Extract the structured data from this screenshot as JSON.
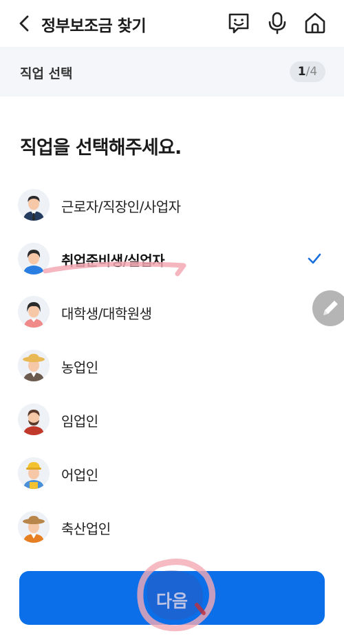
{
  "header": {
    "title": "정부보조금 찾기",
    "back_icon": "chevron-left-icon",
    "icons": [
      "chat-smile-icon",
      "microphone-icon",
      "home-icon"
    ]
  },
  "step": {
    "label": "직업 선택",
    "current": "1",
    "separator": "/",
    "total": "4"
  },
  "main": {
    "heading": "직업을 선택해주세요.",
    "occupations": [
      {
        "label": "근로자/직장인/사업자",
        "selected": false
      },
      {
        "label": "취업준비생/실업자",
        "selected": true
      },
      {
        "label": "대학생/대학원생",
        "selected": false
      },
      {
        "label": "농업인",
        "selected": false
      },
      {
        "label": "임업인",
        "selected": false
      },
      {
        "label": "어업인",
        "selected": false
      },
      {
        "label": "축산업인",
        "selected": false
      }
    ]
  },
  "footer": {
    "next_label": "다음"
  },
  "colors": {
    "accent": "#0a6fe8",
    "check": "#1a6fe0",
    "subbar_bg": "#f4f6f9"
  }
}
